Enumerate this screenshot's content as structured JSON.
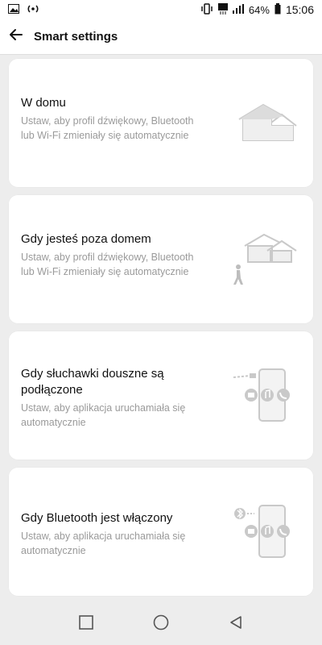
{
  "status_bar": {
    "battery_percent_text": "64%",
    "time": "15:06",
    "battery_level": 0.64,
    "icons": [
      "gallery-icon",
      "hotspot-icon",
      "vibrate-icon",
      "lte-icon",
      "signal-icon",
      "battery-icon"
    ]
  },
  "appbar": {
    "title": "Smart settings",
    "back_icon": "back-arrow-icon"
  },
  "cards": [
    {
      "title": "W domu",
      "description": "Ustaw, aby profil dźwiękowy, Bluetooth lub Wi-Fi zmieniały się automatycznie",
      "illustration": "house-icon"
    },
    {
      "title": "Gdy jesteś poza domem",
      "description": "Ustaw, aby profil dźwiękowy, Bluetooth lub Wi-Fi zmieniały się automatycznie",
      "illustration": "walking-away-house-icon"
    },
    {
      "title": "Gdy słuchawki douszne są podłączone",
      "description": "Ustaw, aby aplikacja uruchamiała się automatycznie",
      "illustration": "earphones-phone-icon"
    },
    {
      "title": "Gdy Bluetooth jest włączony",
      "description": "Ustaw, aby aplikacja uruchamiała się automatycznie",
      "illustration": "bluetooth-phone-icon"
    }
  ],
  "navigation_bar": {
    "buttons": [
      "recent-apps-icon",
      "home-icon",
      "back-icon"
    ]
  },
  "colors": {
    "page_background": "#ededed",
    "card_background": "#ffffff",
    "primary_text": "#111111",
    "secondary_text": "#9a9a9a",
    "illustration": "#c9c9c9"
  }
}
